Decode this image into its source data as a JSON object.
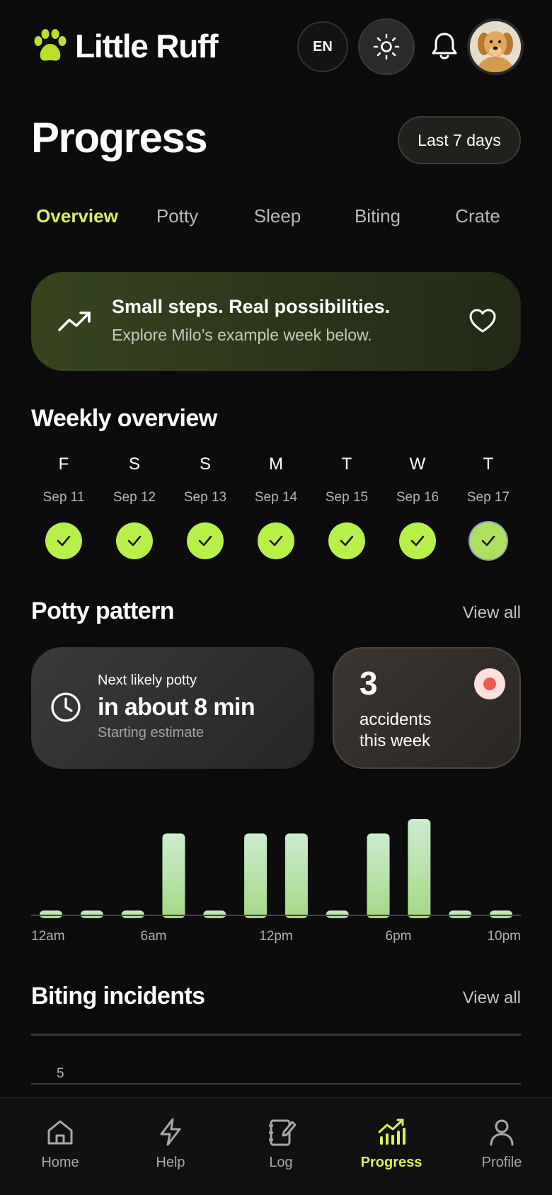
{
  "app": {
    "name": "Little Ruff"
  },
  "header": {
    "language": "EN"
  },
  "page": {
    "title": "Progress",
    "range": "Last 7 days"
  },
  "tabs": [
    {
      "label": "Overview",
      "active": true
    },
    {
      "label": "Potty"
    },
    {
      "label": "Sleep"
    },
    {
      "label": "Biting"
    },
    {
      "label": "Crate"
    }
  ],
  "banner": {
    "title": "Small steps. Real possibilities.",
    "subtitle": "Explore Milo’s example week below."
  },
  "weekly": {
    "title": "Weekly overview",
    "days": [
      {
        "letter": "F",
        "date": "Sep 11",
        "done": true
      },
      {
        "letter": "S",
        "date": "Sep 12",
        "done": true
      },
      {
        "letter": "S",
        "date": "Sep 13",
        "done": true
      },
      {
        "letter": "M",
        "date": "Sep 14",
        "done": true
      },
      {
        "letter": "T",
        "date": "Sep 15",
        "done": true
      },
      {
        "letter": "W",
        "date": "Sep 16",
        "done": true
      },
      {
        "letter": "T",
        "date": "Sep 17",
        "done": true,
        "today": true
      }
    ]
  },
  "potty": {
    "title": "Potty pattern",
    "view_all": "View all",
    "next_label": "Next likely potty",
    "next_value": "in about 8 min",
    "next_sub": "Starting estimate",
    "accidents_count": "3",
    "accidents_label": "accidents this week"
  },
  "chart_data": {
    "type": "bar",
    "x_labels": [
      "12am",
      "6am",
      "12pm",
      "6pm",
      "10pm"
    ],
    "values": [
      0.05,
      0.05,
      0.05,
      0.85,
      0.05,
      0.85,
      0.85,
      0.05,
      0.85,
      1.0,
      0.05,
      0.05
    ],
    "ylim": [
      0,
      1
    ],
    "colors": {
      "bar_top": "#cdeccf",
      "bar_bottom": "#a3d983"
    }
  },
  "biting": {
    "title": "Biting incidents",
    "view_all": "View all",
    "axis_value": "5"
  },
  "nav": [
    {
      "label": "Home",
      "icon": "home-icon"
    },
    {
      "label": "Help",
      "icon": "lightning-icon"
    },
    {
      "label": "Log",
      "icon": "notebook-icon"
    },
    {
      "label": "Progress",
      "icon": "chart-icon",
      "active": true
    },
    {
      "label": "Profile",
      "icon": "user-icon"
    }
  ],
  "colors": {
    "accent": "#d9f25a",
    "check": "#b8f04a",
    "alert": "#ef5b52"
  }
}
